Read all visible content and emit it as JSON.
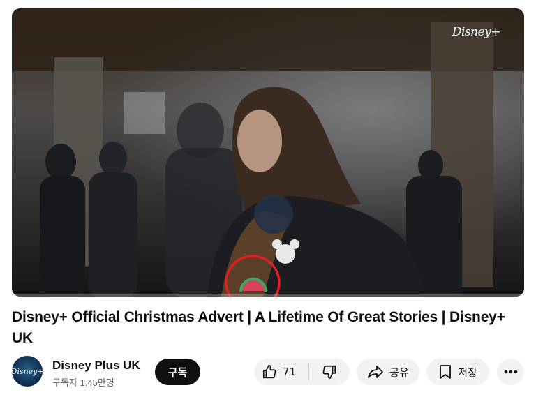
{
  "video": {
    "watermark": "Disney+",
    "progress_fraction": 0.0
  },
  "title": "Disney+ Official Christmas Advert | A Lifetime Of Great Stories | Disney+ UK",
  "channel": {
    "name": "Disney Plus UK",
    "subscribers": "구독자 1.45만명",
    "avatar_text": "Disney+"
  },
  "actions": {
    "subscribe_label": "구독",
    "like_count": "71",
    "share_label": "공유",
    "save_label": "저장"
  },
  "colors": {
    "subscribe_bg": "#0f0f0f",
    "pill_bg": "#f2f2f2",
    "annotation_circle": "#e02020"
  },
  "icons": [
    "thumbs-up-icon",
    "thumbs-down-icon",
    "share-icon",
    "bookmark-icon",
    "more-icon"
  ]
}
